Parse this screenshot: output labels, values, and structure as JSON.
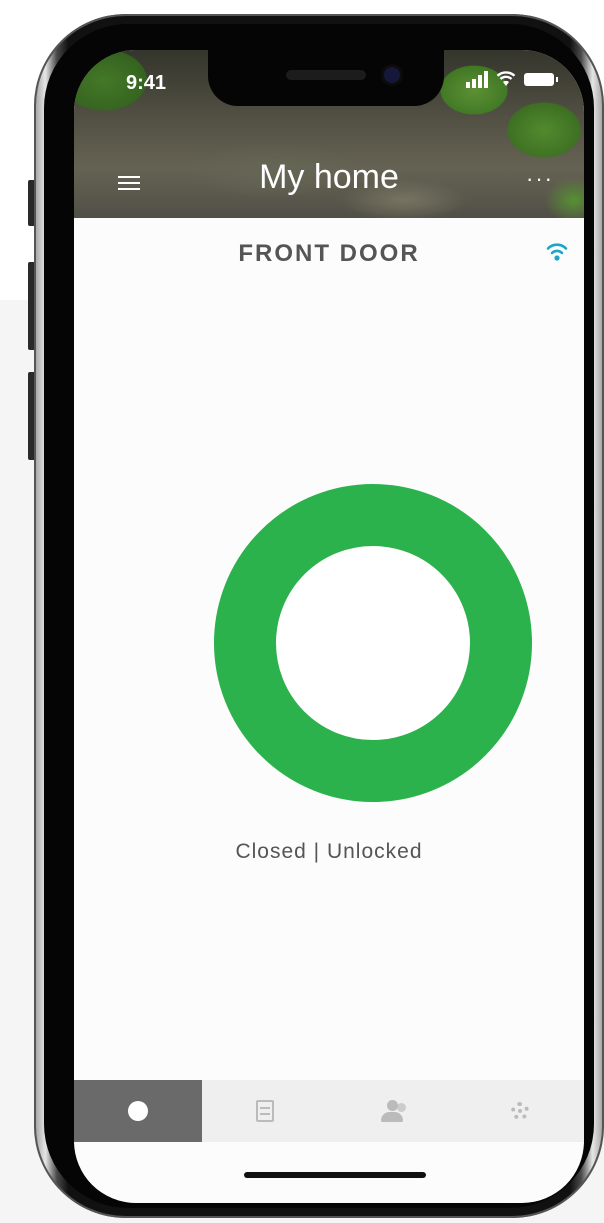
{
  "status_bar": {
    "time": "9:41"
  },
  "header": {
    "title": "My home",
    "menu_icon": "hamburger-menu-icon",
    "more_icon": "more-options-icon",
    "more_label": "···"
  },
  "lock": {
    "name": "FRONT DOOR",
    "connection_icon": "wifi-icon",
    "state_color": "#2bb24c",
    "status": "Closed | Unlocked"
  },
  "tabbar": {
    "tabs": [
      {
        "icon": "lock-dot-icon",
        "active": true
      },
      {
        "icon": "list-icon",
        "active": false
      },
      {
        "icon": "users-icon",
        "active": false
      },
      {
        "icon": "gear-icon",
        "active": false
      }
    ]
  },
  "colors": {
    "accent": "#2bb24c",
    "wifi": "#1aa6c8",
    "tab_active": "#6a6a6a"
  }
}
